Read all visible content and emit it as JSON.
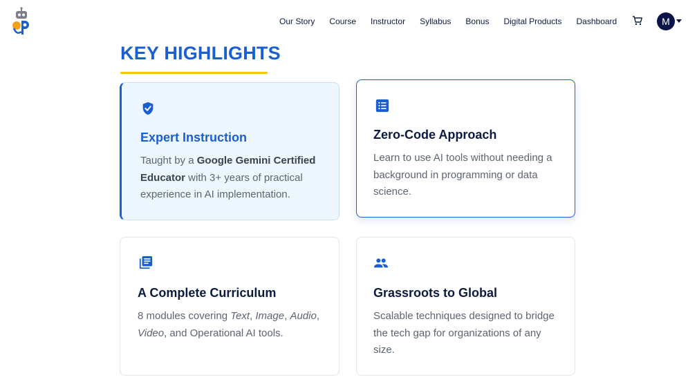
{
  "header": {
    "logo": "robot-logo",
    "nav": [
      "Our Story",
      "Course",
      "Instructor",
      "Syllabus",
      "Bonus",
      "Digital Products",
      "Dashboard"
    ],
    "cart_icon": "cart-icon",
    "avatar_initial": "M"
  },
  "section": {
    "title": "KEY HIGHLIGHTS"
  },
  "colors": {
    "accent": "#1a5fd1",
    "underline": "#f5c518",
    "active_bg": "#eef6ff",
    "avatar_bg": "#0b1446"
  },
  "cards": [
    {
      "icon": "shield-check-icon",
      "title": "Expert Instruction",
      "desc_parts": [
        "Taught by a ",
        "Google Gemini Certified Educator",
        " with 3+ years of practical experience in AI implementation."
      ]
    },
    {
      "icon": "list-icon",
      "title": "Zero-Code Approach",
      "desc": "Learn to use AI tools without needing a background in programming or data science."
    },
    {
      "icon": "library-books-icon",
      "title": "A Complete Curriculum",
      "desc_parts": [
        "8 modules covering ",
        "Text",
        ", ",
        "Image",
        ", ",
        "Audio",
        ", ",
        "Video",
        ", and Operational AI tools."
      ]
    },
    {
      "icon": "people-icon",
      "title": "Grassroots to Global",
      "desc": "Scalable techniques designed to bridge the tech gap for organizations of any size."
    }
  ]
}
